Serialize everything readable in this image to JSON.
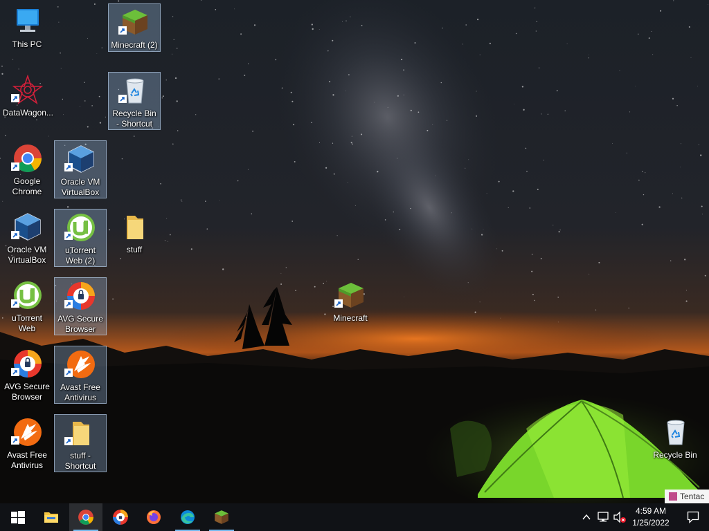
{
  "desktop": {
    "icons": [
      {
        "label": "This PC",
        "icon": "computer-icon",
        "shortcut": false,
        "selected": false
      },
      {
        "label": "DataWagon...",
        "icon": "datawagon-icon",
        "shortcut": true,
        "selected": false
      },
      {
        "label": "Google Chrome",
        "icon": "chrome-icon",
        "shortcut": true,
        "selected": false
      },
      {
        "label": "Oracle VM VirtualBox",
        "icon": "virtualbox-icon",
        "shortcut": true,
        "selected": false
      },
      {
        "label": "uTorrent Web",
        "icon": "utorrent-icon",
        "shortcut": true,
        "selected": false
      },
      {
        "label": "AVG Secure Browser",
        "icon": "avg-browser-icon",
        "shortcut": true,
        "selected": false
      },
      {
        "label": "Avast Free Antivirus",
        "icon": "avast-icon",
        "shortcut": true,
        "selected": false
      },
      {
        "label": "Oracle VM VirtualBox",
        "icon": "virtualbox-icon",
        "shortcut": true,
        "selected": true
      },
      {
        "label": "uTorrent Web (2)",
        "icon": "utorrent-icon",
        "shortcut": true,
        "selected": true
      },
      {
        "label": "AVG Secure Browser",
        "icon": "avg-browser-icon",
        "shortcut": true,
        "selected": true
      },
      {
        "label": "Avast Free Antivirus",
        "icon": "avast-icon",
        "shortcut": true,
        "selected": true
      },
      {
        "label": "stuff - Shortcut",
        "icon": "folder-icon",
        "shortcut": true,
        "selected": true
      },
      {
        "label": "Minecraft (2)",
        "icon": "minecraft-icon",
        "shortcut": true,
        "selected": true
      },
      {
        "label": "Recycle Bin - Shortcut",
        "icon": "recycle-bin-icon",
        "shortcut": true,
        "selected": true
      },
      {
        "label": "stuff",
        "icon": "folder-icon",
        "shortcut": false,
        "selected": false
      },
      {
        "label": "Minecraft",
        "icon": "minecraft-icon",
        "shortcut": true,
        "selected": false
      },
      {
        "label": "Recycle Bin",
        "icon": "recycle-bin-icon",
        "shortcut": false,
        "selected": false
      }
    ]
  },
  "peek_window": {
    "text": "Tentac"
  },
  "taskbar": {
    "start_icon": "windows-logo-icon",
    "apps": [
      {
        "name": "File Explorer",
        "icon": "file-explorer-icon",
        "running": false,
        "active": false
      },
      {
        "name": "Google Chrome",
        "icon": "chrome-icon",
        "running": true,
        "active": true
      },
      {
        "name": "AVG Secure Browser",
        "icon": "avg-browser-icon",
        "running": false,
        "active": false
      },
      {
        "name": "Firefox",
        "icon": "firefox-icon",
        "running": false,
        "active": false
      },
      {
        "name": "Microsoft Edge",
        "icon": "edge-icon",
        "running": true,
        "active": false
      },
      {
        "name": "Minecraft",
        "icon": "minecraft-icon",
        "running": true,
        "active": false
      }
    ],
    "tray": {
      "chevron_icon": "chevron-up-icon",
      "network_icon": "network-icon",
      "volume_icon": "volume-muted-icon",
      "time": "4:59 AM",
      "date": "1/25/2022",
      "notification_icon": "notification-icon"
    }
  },
  "colors": {
    "taskbar": "#101216",
    "running_indicator": "#76b9ed",
    "selection": "#aacdf5",
    "tent": "#7edc2a"
  }
}
